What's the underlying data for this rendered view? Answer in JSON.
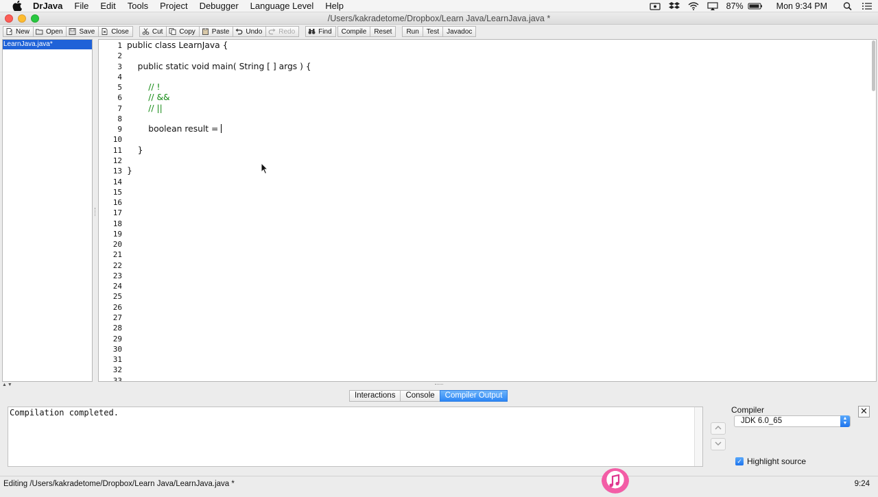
{
  "menubar": {
    "app": "DrJava",
    "items": [
      "File",
      "Edit",
      "Tools",
      "Project",
      "Debugger",
      "Language Level",
      "Help"
    ],
    "battery": "87%",
    "clock": "Mon 9:34 PM"
  },
  "window": {
    "title": "/Users/kakradetome/Dropbox/Learn Java/LearnJava.java *"
  },
  "toolbar": {
    "new": "New",
    "open": "Open",
    "save": "Save",
    "close": "Close",
    "cut": "Cut",
    "copy": "Copy",
    "paste": "Paste",
    "undo": "Undo",
    "redo": "Redo",
    "find": "Find",
    "compile": "Compile",
    "reset": "Reset",
    "run": "Run",
    "test": "Test",
    "javadoc": "Javadoc"
  },
  "files": {
    "selected": "LearnJava.java*"
  },
  "editor": {
    "line_count": 33,
    "lines": [
      {
        "n": 1,
        "text": "public class LearnJava {",
        "type": "code"
      },
      {
        "n": 3,
        "text": "    public static void main( String [ ] args ) {",
        "type": "code"
      },
      {
        "n": 5,
        "text": "        // !",
        "type": "comment"
      },
      {
        "n": 6,
        "text": "        // &&",
        "type": "comment"
      },
      {
        "n": 7,
        "text": "        // ||",
        "type": "comment"
      },
      {
        "n": 9,
        "text": "        boolean result = ",
        "type": "code",
        "cursor": true
      },
      {
        "n": 11,
        "text": "    }",
        "type": "code"
      },
      {
        "n": 13,
        "text": "}",
        "type": "code"
      }
    ]
  },
  "bottom": {
    "tabs": [
      "Interactions",
      "Console",
      "Compiler Output"
    ],
    "active_tab": "Compiler Output",
    "output": "Compilation completed.",
    "compiler_label": "Compiler",
    "compiler_value": "JDK 6.0_65",
    "highlight_label": "Highlight source",
    "highlight_checked": true
  },
  "status": {
    "text": "Editing /Users/kakradetome/Dropbox/Learn Java/LearnJava.java *",
    "position": "9:24"
  },
  "colors": {
    "comment": "#138a13",
    "selection": "#1f62d8",
    "active_tab": "#2d86f5"
  }
}
